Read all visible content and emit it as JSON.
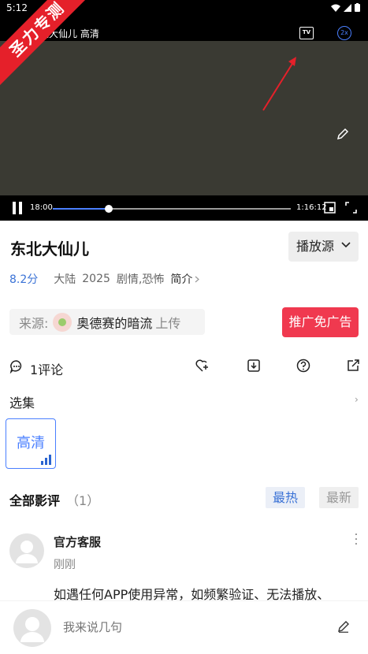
{
  "status": {
    "time": "5:12"
  },
  "ribbon": {
    "text": "圣力专测"
  },
  "player": {
    "top_title": "北大仙儿 高清",
    "tv_label": "TV",
    "speed_label": "2x",
    "current_time": "18:00",
    "total_time": "1:16:12",
    "progress": 0.235
  },
  "movie": {
    "title": "东北大仙儿",
    "source_button": "播放源",
    "score": "8.2分",
    "region": "大陆",
    "year": "2025",
    "genre": "剧情,恐怖",
    "intro": "简介"
  },
  "uploader": {
    "prefix": "来源:",
    "name": "奥德赛的暗流",
    "suffix": "上传",
    "ad_button": "推广免广告"
  },
  "actions": {
    "comment_count": "1评论"
  },
  "episodes": {
    "label": "选集",
    "more": "›",
    "items": [
      "高清"
    ]
  },
  "reviews": {
    "title": "全部影评",
    "count": "（1）",
    "sort_hot": "最热",
    "sort_new": "最新",
    "items": [
      {
        "author": "官方客服",
        "time": "刚刚",
        "text": "如遇任何APP使用异常，如频繁验证、无法播放、"
      }
    ]
  },
  "input": {
    "placeholder": "我来说几句"
  },
  "colors": {
    "accent": "#3a72d6",
    "ad": "#f0394f",
    "ribbon": "#e5202a"
  }
}
